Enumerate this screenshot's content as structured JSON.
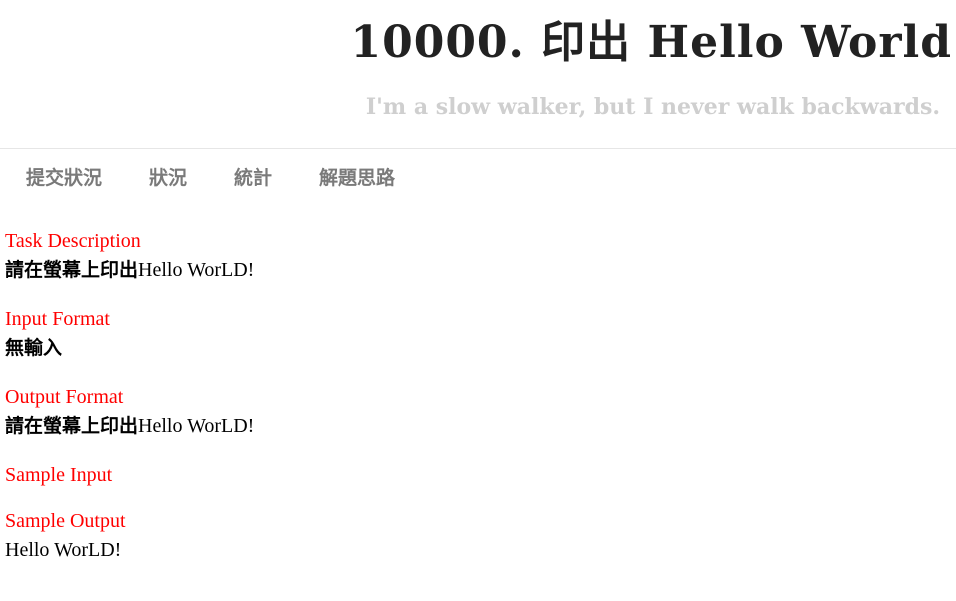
{
  "header": {
    "title": "10000. 印出 Hello World",
    "tagline": "I'm a slow walker, but I never walk backwards."
  },
  "nav": {
    "items": [
      {
        "label": "提交狀況"
      },
      {
        "label": "狀況"
      },
      {
        "label": "統計"
      },
      {
        "label": "解題思路"
      }
    ]
  },
  "problem": {
    "task_description": {
      "title": "Task Description",
      "body_cjk": "請在螢幕上印出",
      "body_latin": "Hello WorLD!"
    },
    "input_format": {
      "title": "Input Format",
      "body_cjk": "無輸入"
    },
    "output_format": {
      "title": "Output Format",
      "body_cjk": "請在螢幕上印出",
      "body_latin": "Hello WorLD!"
    },
    "sample_input": {
      "title": "Sample Input"
    },
    "sample_output": {
      "title": "Sample Output",
      "body": "Hello WorLD!"
    }
  },
  "colors": {
    "section_title": "#ff0000",
    "title_text": "#222222",
    "tagline_text": "#cfcfcf",
    "nav_text": "#7a7a7a"
  }
}
